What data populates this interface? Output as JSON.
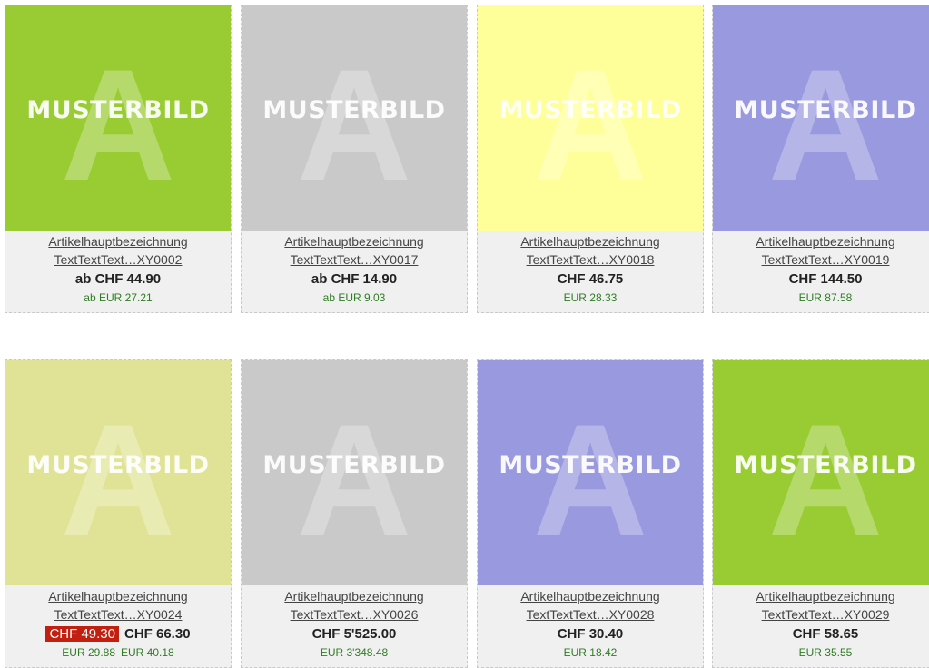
{
  "watermark": "MUSTERBILD",
  "watermark_letter": "A",
  "products": [
    {
      "color": "#99cc33",
      "name1": "Artikelhauptbezeichnung",
      "name2": "TextTextText…XY0002",
      "chf": "ab CHF 44.90",
      "eur": "ab EUR 27.21"
    },
    {
      "color": "#c9c9c9",
      "name1": "Artikelhauptbezeichnung",
      "name2": "TextTextText…XY0017",
      "chf": "ab CHF 14.90",
      "eur": "ab EUR 9.03"
    },
    {
      "color": "#ffff99",
      "name1": "Artikelhauptbezeichnung",
      "name2": "TextTextText…XY0018",
      "chf": "CHF 46.75",
      "eur": "EUR 28.33"
    },
    {
      "color": "#9999e0",
      "name1": "Artikelhauptbezeichnung",
      "name2": "TextTextText…XY0019",
      "chf": "CHF 144.50",
      "eur": "EUR 87.58"
    },
    {
      "color": "#e0e395",
      "name1": "Artikelhauptbezeichnung",
      "name2": "TextTextText…XY0024",
      "chf_sale": "CHF 49.30",
      "chf_old": "CHF 66.30",
      "eur": "EUR 29.88",
      "eur_old": "EUR 40.18"
    },
    {
      "color": "#c9c9c9",
      "name1": "Artikelhauptbezeichnung",
      "name2": "TextTextText…XY0026",
      "chf": "CHF 5'525.00",
      "eur": "EUR 3'348.48"
    },
    {
      "color": "#9999e0",
      "name1": "Artikelhauptbezeichnung",
      "name2": "TextTextText…XY0028",
      "chf": "CHF 30.40",
      "eur": "EUR 18.42"
    },
    {
      "color": "#99cc33",
      "name1": "Artikelhauptbezeichnung",
      "name2": "TextTextText…XY0029",
      "chf": "CHF 58.65",
      "eur": "EUR 35.55"
    }
  ]
}
